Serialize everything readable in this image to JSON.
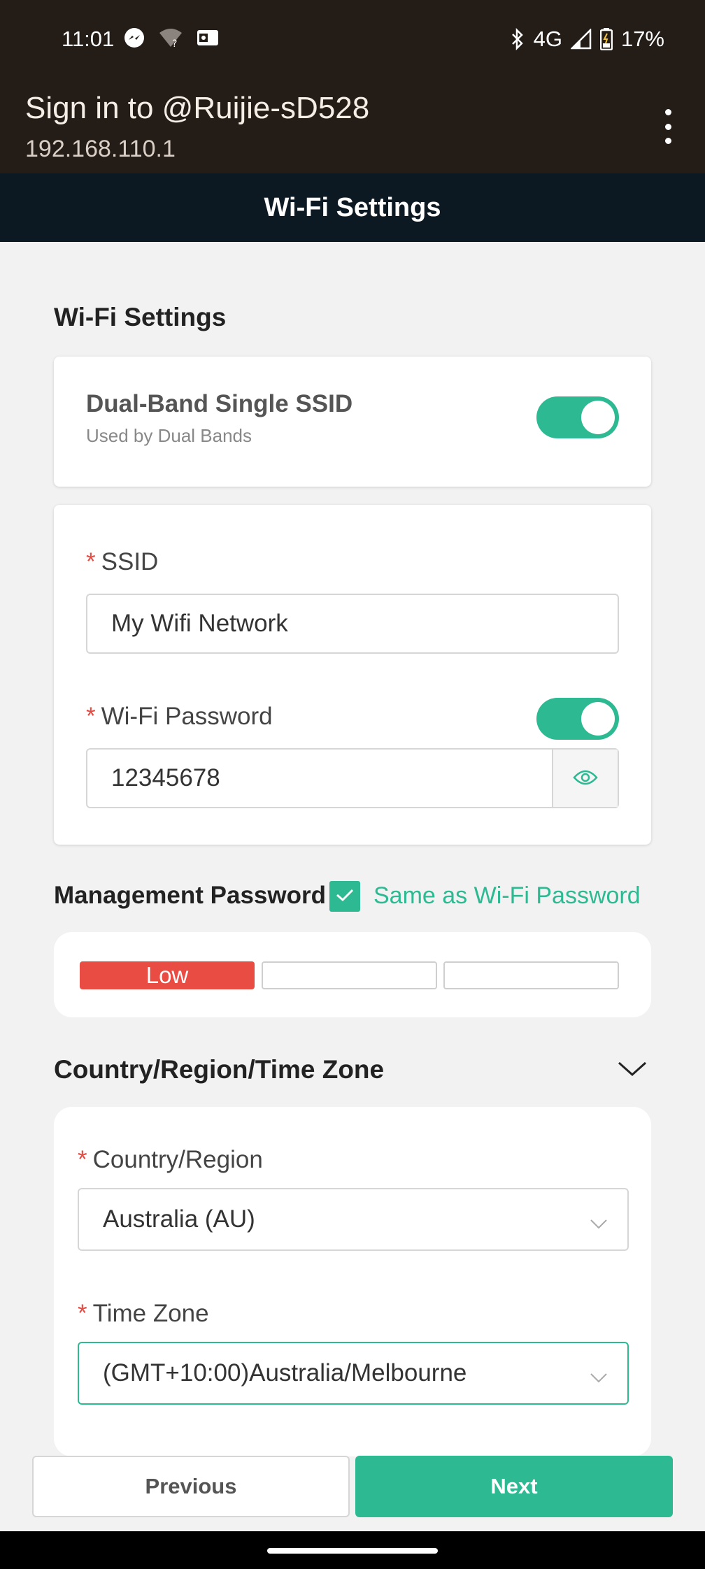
{
  "status_bar": {
    "time": "11:01",
    "network": "4G",
    "battery": "17%",
    "icons": [
      "messenger-icon",
      "wifi-question-icon",
      "outlook-icon",
      "bluetooth-icon",
      "signal-icon",
      "battery-icon"
    ]
  },
  "app_bar": {
    "title": "Sign in to @Ruijie-sD528",
    "subtitle": "192.168.110.1"
  },
  "page_header": {
    "title": "Wi-Fi Settings"
  },
  "wifi_settings": {
    "section_title": "Wi-Fi Settings",
    "dual_band": {
      "title": "Dual-Band Single SSID",
      "subtitle": "Used by Dual Bands",
      "enabled": true
    },
    "ssid": {
      "required_mark": "*",
      "label": "SSID",
      "value": "My Wifi Network"
    },
    "password": {
      "required_mark": "*",
      "label": "Wi-Fi Password",
      "value": "12345678",
      "enabled": true
    }
  },
  "management": {
    "label": "Management Password",
    "same_as_label": "Same as Wi-Fi Password",
    "checked": true,
    "strength": {
      "level_label": "Low",
      "segments_filled": 1,
      "segments_total": 3
    }
  },
  "region": {
    "section_title": "Country/Region/Time Zone",
    "country": {
      "required_mark": "*",
      "label": "Country/Region",
      "value": "Australia (AU)"
    },
    "timezone": {
      "required_mark": "*",
      "label": "Time Zone",
      "value": "(GMT+10:00)Australia/Melbourne"
    }
  },
  "footer": {
    "previous_label": "Previous",
    "next_label": "Next"
  },
  "colors": {
    "accent": "#2dba93",
    "danger": "#e84c42",
    "header_dark": "#0d1922",
    "status_bar": "#241c17"
  }
}
